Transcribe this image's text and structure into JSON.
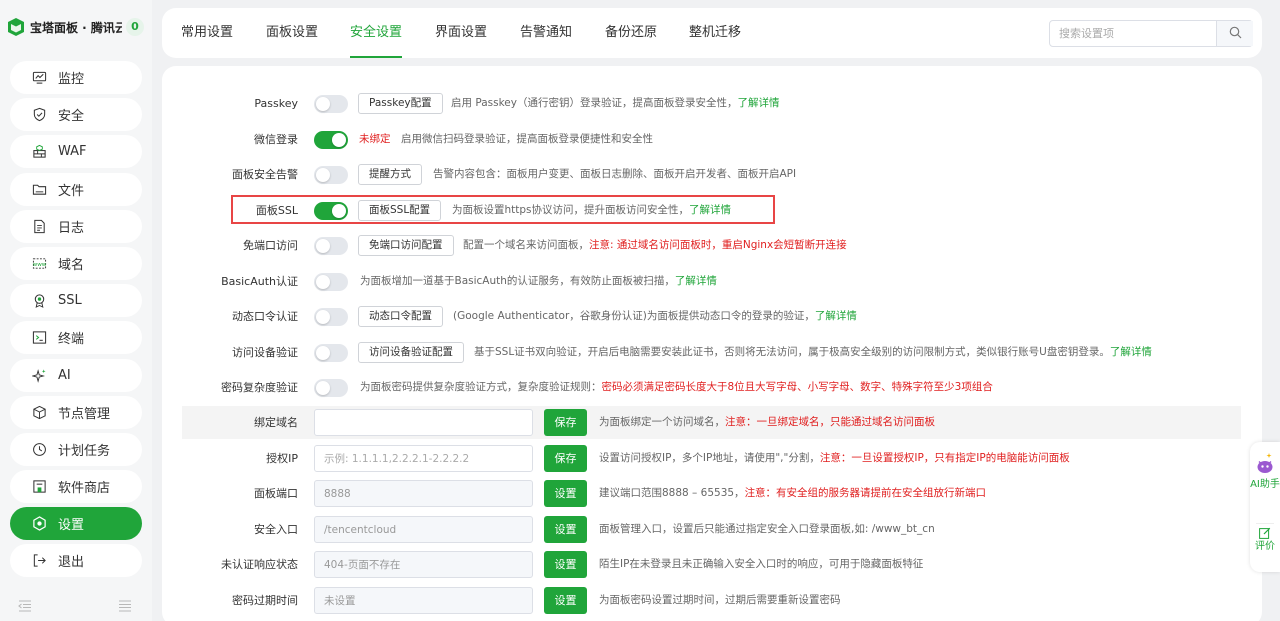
{
  "brand": {
    "title": "宝塔面板 · 腾讯云专",
    "count": "0"
  },
  "nav": {
    "items": [
      {
        "label": "监控",
        "icon": "monitor-icon"
      },
      {
        "label": "安全",
        "icon": "shield-icon"
      },
      {
        "label": "WAF",
        "icon": "waf-icon"
      },
      {
        "label": "文件",
        "icon": "folder-icon"
      },
      {
        "label": "日志",
        "icon": "log-icon"
      },
      {
        "label": "域名",
        "icon": "domain-icon"
      },
      {
        "label": "SSL",
        "icon": "ssl-icon"
      },
      {
        "label": "终端",
        "icon": "terminal-icon"
      },
      {
        "label": "AI",
        "icon": "ai-sparkle-icon"
      },
      {
        "label": "节点管理",
        "icon": "node-cube-icon"
      },
      {
        "label": "计划任务",
        "icon": "clock-icon"
      },
      {
        "label": "软件商店",
        "icon": "store-icon"
      },
      {
        "label": "设置",
        "icon": "settings-icon",
        "active": true
      },
      {
        "label": "退出",
        "icon": "logout-icon"
      }
    ]
  },
  "tabs": [
    {
      "label": "常用设置"
    },
    {
      "label": "面板设置"
    },
    {
      "label": "安全设置",
      "active": true
    },
    {
      "label": "界面设置"
    },
    {
      "label": "告警通知"
    },
    {
      "label": "备份还原"
    },
    {
      "label": "整机迁移"
    }
  ],
  "search": {
    "placeholder": "搜索设置项"
  },
  "settings": {
    "passkey": {
      "label": "Passkey",
      "on": false,
      "button": "Passkey配置",
      "desc": "启用 Passkey（通行密钥）登录验证，提高面板登录安全性，",
      "link": "了解详情"
    },
    "wechat": {
      "label": "微信登录",
      "on": true,
      "status": "未绑定",
      "desc": "启用微信扫码登录验证，提高面板登录便捷性和安全性"
    },
    "alert": {
      "label": "面板安全告警",
      "on": false,
      "button": "提醒方式",
      "desc": "告警内容包含：面板用户变更、面板日志删除、面板开启开发者、面板开启API"
    },
    "ssl": {
      "label": "面板SSL",
      "on": true,
      "button": "面板SSL配置",
      "desc": "为面板设置https协议访问，提升面板访问安全性，",
      "link": "了解详情"
    },
    "noport": {
      "label": "免端口访问",
      "on": false,
      "button": "免端口访问配置",
      "desc": "配置一个域名来访问面板，",
      "warn": "注意: 通过域名访问面板时，重启Nginx会短暂断开连接"
    },
    "basicauth": {
      "label": "BasicAuth认证",
      "on": false,
      "desc": "为面板增加一道基于BasicAuth的认证服务，有效防止面板被扫描，",
      "link": "了解详情"
    },
    "totp": {
      "label": "动态口令认证",
      "on": false,
      "button": "动态口令配置",
      "desc": "(Google Authenticator，谷歌身份认证)为面板提供动态口令的登录的验证，",
      "link": "了解详情"
    },
    "device": {
      "label": "访问设备验证",
      "on": false,
      "button": "访问设备验证配置",
      "desc": "基于SSL证书双向验证，开启后电脑需要安装此证书，否则将无法访问，属于极高安全级别的访问限制方式，类似银行账号U盘密钥登录。",
      "link": "了解详情"
    },
    "pwdcomplex": {
      "label": "密码复杂度验证",
      "on": false,
      "desc": "为面板密码提供复杂度验证方式，复杂度验证规则：",
      "warn": "密码必须满足密码长度大于8位且大写字母、小写字母、数字、特殊字符至少3项组合"
    },
    "bind_domain": {
      "label": "绑定域名",
      "value": "",
      "placeholder": "",
      "button": "保存",
      "desc": "为面板绑定一个访问域名，",
      "warn": "注意：一旦绑定域名，只能通过域名访问面板"
    },
    "auth_ip": {
      "label": "授权IP",
      "value": "",
      "placeholder": "示例: 1.1.1.1,2.2.2.1-2.2.2.2",
      "button": "保存",
      "desc": "设置访问授权IP，多个IP地址，请使用\",\"分割，",
      "warn": "注意：一旦设置授权IP，只有指定IP的电脑能访问面板"
    },
    "port": {
      "label": "面板端口",
      "value": "8888",
      "button": "设置",
      "desc": "建议端口范围8888 – 65535，",
      "warn": "注意：有安全组的服务器请提前在安全组放行新端口"
    },
    "entry": {
      "label": "安全入口",
      "value": "/tencentcloud",
      "button": "设置",
      "desc": "面板管理入口，设置后只能通过指定安全入口登录面板,如: /www_bt_cn"
    },
    "unauth": {
      "label": "未认证响应状态",
      "value": "404-页面不存在",
      "button": "设置",
      "desc": "陌生IP在未登录且未正确输入安全入口时的响应，可用于隐藏面板特征"
    },
    "pwd_expire": {
      "label": "密码过期时间",
      "value": "未设置",
      "button": "设置",
      "desc": "为面板密码设置过期时间，过期后需要重新设置密码"
    }
  },
  "helper": {
    "ai_label": "AI助手",
    "rate_label": "评价"
  },
  "colors": {
    "accent": "#20a53a",
    "danger": "#e02020",
    "highlight": "#e84545"
  }
}
